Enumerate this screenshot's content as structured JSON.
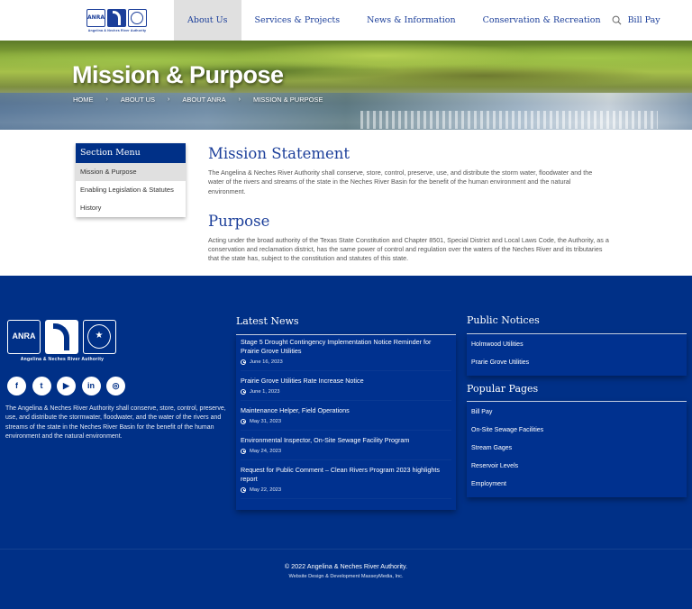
{
  "header": {
    "logo": {
      "abbr": "ANRA",
      "tagline": "Angelina & Neches River Authority"
    },
    "nav": [
      {
        "label": "About Us",
        "active": true
      },
      {
        "label": "Services & Projects",
        "active": false
      },
      {
        "label": "News & Information",
        "active": false
      },
      {
        "label": "Conservation & Recreation",
        "active": false
      },
      {
        "label": "Bill Pay",
        "active": false
      }
    ],
    "search_icon": "search-icon"
  },
  "hero": {
    "title": "Mission & Purpose",
    "breadcrumb": [
      "Home",
      "About Us",
      "About ANRA",
      "Mission & Purpose"
    ],
    "separator": "›"
  },
  "section_menu": {
    "title": "Section Menu",
    "items": [
      {
        "label": "Mission & Purpose",
        "active": true
      },
      {
        "label": "Enabling Legislation & Statutes",
        "active": false
      },
      {
        "label": "History",
        "active": false
      }
    ]
  },
  "main": {
    "mission_heading": "Mission Statement",
    "mission_text": "The Angelina & Neches River Authority shall conserve, store, control, preserve, use, and distribute the storm water, floodwater and the water of the rivers and streams of the state in the Neches River Basin for the benefit of the human environment and the natural environment.",
    "purpose_heading": "Purpose",
    "purpose_text": "Acting under the broad authority of the Texas State Constitution and Chapter 8501, Special District and Local Laws Code, the Authority, as a conservation and reclamation district, has the same power of control and regulation over the waters of the Neches River and its tributaries that the state has, subject to the constitution and statutes of this state."
  },
  "footer": {
    "logo": {
      "abbr": "ANRA",
      "tagline": "Angelina & Neches River Authority"
    },
    "socials": [
      {
        "name": "facebook",
        "glyph": "f"
      },
      {
        "name": "twitter",
        "glyph": "t"
      },
      {
        "name": "youtube",
        "glyph": "▶"
      },
      {
        "name": "linkedin",
        "glyph": "in"
      },
      {
        "name": "instagram",
        "glyph": "◎"
      }
    ],
    "about": "The Angelina & Neches River Authority shall conserve, store, control, preserve, use, and distribute the stormwater, floodwater, and the water of the rivers and streams of the state in the Neches River Basin for the benefit of the human environment and the natural environment.",
    "latest_news": {
      "title": "Latest News",
      "items": [
        {
          "title": "Stage 5 Drought Contingency Implementation Notice Reminder for Prairie Grove Utilities",
          "date": "June 16, 2023"
        },
        {
          "title": "Prairie Grove Utilities Rate Increase Notice",
          "date": "June 1, 2023"
        },
        {
          "title": "Maintenance Helper, Field Operations",
          "date": "May 31, 2023"
        },
        {
          "title": "Environmental Inspector, On-Site Sewage Facility Program",
          "date": "May 24, 2023"
        },
        {
          "title": "Request for Public Comment – Clean Rivers Program 2023 highlights report",
          "date": "May 22, 2023"
        }
      ]
    },
    "public_notices": {
      "title": "Public Notices",
      "items": [
        "Holmwood Utilities",
        "Prarie Grove Utilities"
      ]
    },
    "popular_pages": {
      "title": "Popular Pages",
      "items": [
        "Bill Pay",
        "On-Site Sewage Facilities",
        "Stream Gages",
        "Reservoir Levels",
        "Employment"
      ]
    },
    "copyright": "© 2022 Angelina & Neches River Authority.",
    "credit": "Website Design & Development MasseyMedia, Inc."
  },
  "colors": {
    "brand_blue": "#003087",
    "heading_blue": "#1c3f9a",
    "nav_active_bg": "#e0e0e0"
  }
}
